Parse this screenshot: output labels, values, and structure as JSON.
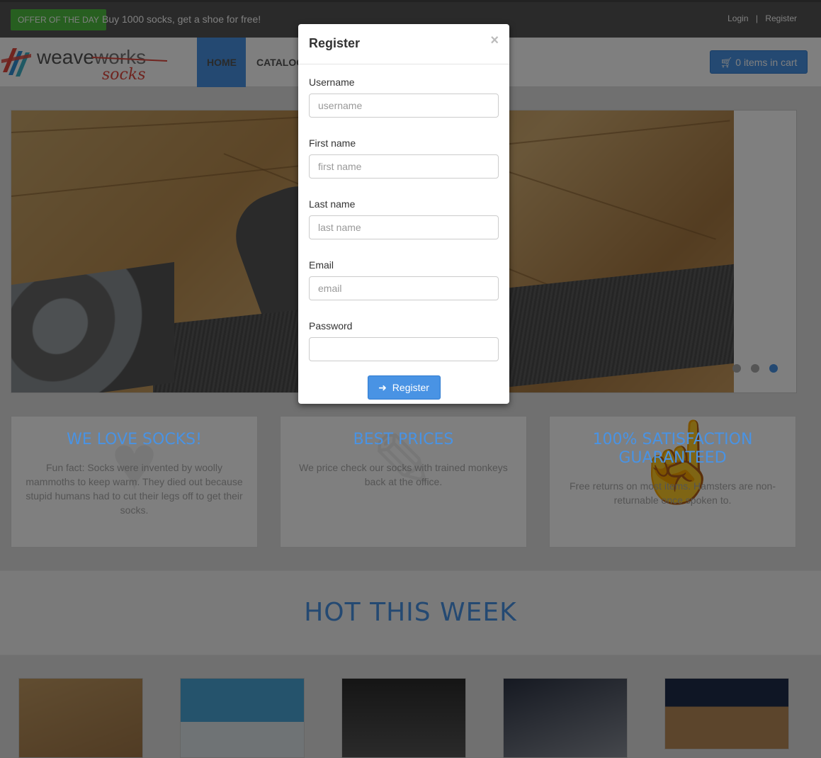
{
  "topbar": {
    "offer_badge": "OFFER OF THE DAY",
    "offer_text": "Buy 1000 socks, get a shoe for free!",
    "login": "Login",
    "separator": "|",
    "register": "Register"
  },
  "navbar": {
    "logo_alt": "weaveworks socks",
    "items": [
      {
        "label": "HOME"
      },
      {
        "label": "CATALOGUE"
      }
    ],
    "cart_label": "0 items in cart",
    "cart_icon": "shopping-cart-icon"
  },
  "hero": {
    "dots": 3,
    "active_dot": 3
  },
  "features": [
    {
      "title": "WE LOVE SOCKS!",
      "text": "Fun fact: Socks were invented by woolly mammoths to keep warm. They died out because stupid humans had to cut their legs off to get their socks.",
      "icon": "heart-icon"
    },
    {
      "title": "BEST PRICES",
      "text": "We price check our socks with trained monkeys back at the office.",
      "icon": "tag-icon"
    },
    {
      "title": "100% SATISFACTION GUARANTEED",
      "text": "Free returns on most items. Hamsters are non-returnable once spoken to.",
      "icon": "thumbs-up-icon"
    }
  ],
  "hot_section": {
    "title": "HOT THIS WEEK"
  },
  "modal": {
    "title": "Register",
    "close": "×",
    "fields": [
      {
        "label": "Username",
        "placeholder": "username",
        "value": ""
      },
      {
        "label": "First name",
        "placeholder": "first name",
        "value": ""
      },
      {
        "label": "Last name",
        "placeholder": "last name",
        "value": ""
      },
      {
        "label": "Email",
        "placeholder": "email",
        "value": ""
      },
      {
        "label": "Password",
        "placeholder": "",
        "value": ""
      }
    ],
    "submit_label": "Register",
    "submit_icon": "sign-in-icon"
  },
  "colors": {
    "accent": "#4993e4",
    "offer_green": "#4fbf40",
    "topbar": "#555555"
  }
}
